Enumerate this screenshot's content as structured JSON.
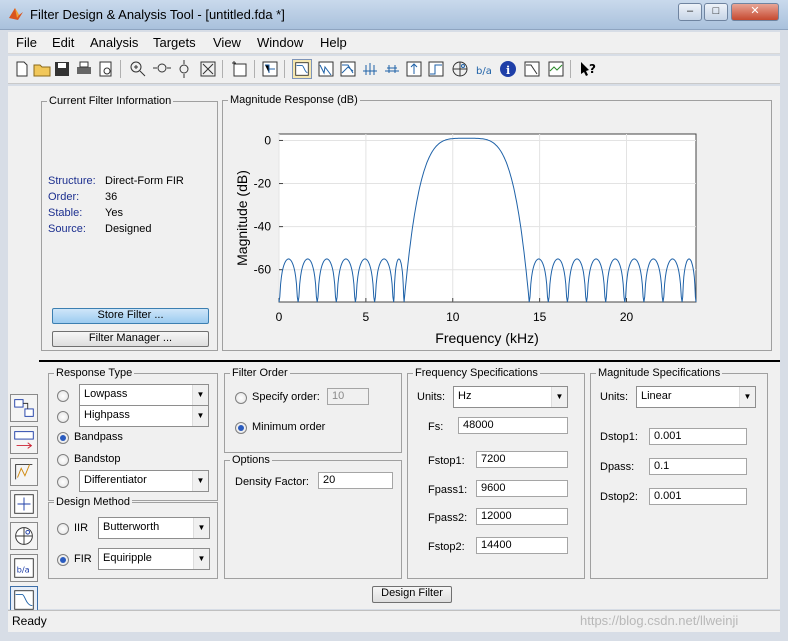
{
  "window": {
    "title": "Filter Design & Analysis Tool  - [untitled.fda *]",
    "min_glyph": "–",
    "max_glyph": "□",
    "close_glyph": "✕"
  },
  "menu": [
    "File",
    "Edit",
    "Analysis",
    "Targets",
    "View",
    "Window",
    "Help"
  ],
  "current_filter": {
    "title": "Current Filter Information",
    "structure_label": "Structure:",
    "structure_value": "Direct-Form FIR",
    "order_label": "Order:",
    "order_value": "36",
    "stable_label": "Stable:",
    "stable_value": "Yes",
    "source_label": "Source:",
    "source_value": "Designed",
    "store_button": "Store Filter ...",
    "manager_button": "Filter Manager ..."
  },
  "plot": {
    "panel_title": "Magnitude Response (dB)",
    "colors": {
      "line": "#1f62a8",
      "grid": "#e3e3e3"
    }
  },
  "chart_data": {
    "type": "line",
    "title": "",
    "xlabel": "Frequency (kHz)",
    "ylabel": "Magnitude (dB)",
    "xlim": [
      0,
      24
    ],
    "ylim": [
      -75,
      3
    ],
    "xticks": [
      0,
      5,
      10,
      15,
      20
    ],
    "yticks": [
      0,
      -20,
      -40,
      -60
    ],
    "grid": true,
    "passband_khz": [
      9.6,
      12.0
    ],
    "stopband_edges_khz": [
      7.2,
      14.4
    ],
    "stopband_level_db": -55,
    "series": [
      {
        "values_desc": "equiripple bandpass response"
      }
    ]
  },
  "response_type": {
    "title": "Response Type",
    "options": [
      {
        "label": "Lowpass",
        "kind": "select"
      },
      {
        "label": "Highpass",
        "kind": "select"
      },
      {
        "label": "Bandpass",
        "kind": "text",
        "selected": true
      },
      {
        "label": "Bandstop",
        "kind": "text"
      },
      {
        "label": "Differentiator",
        "kind": "select"
      }
    ]
  },
  "design_method": {
    "title": "Design Method",
    "iir_label": "IIR",
    "iir_value": "Butterworth",
    "fir_label": "FIR",
    "fir_value": "Equiripple"
  },
  "filter_order": {
    "title": "Filter Order",
    "specify_label": "Specify order:",
    "specify_value": "10",
    "minimum_label": "Minimum order"
  },
  "options": {
    "title": "Options",
    "density_label": "Density Factor:",
    "density_value": "20"
  },
  "freq_specs": {
    "title": "Frequency Specifications",
    "units_label": "Units:",
    "units_value": "Hz",
    "fs_label": "Fs:",
    "fs_value": "48000",
    "fstop1_label": "Fstop1:",
    "fstop1_value": "7200",
    "fpass1_label": "Fpass1:",
    "fpass1_value": "9600",
    "fpass2_label": "Fpass2:",
    "fpass2_value": "12000",
    "fstop2_label": "Fstop2:",
    "fstop2_value": "14400"
  },
  "mag_specs": {
    "title": "Magnitude Specifications",
    "units_label": "Units:",
    "units_value": "Linear",
    "dstop1_label": "Dstop1:",
    "dstop1_value": "0.001",
    "dpass_label": "Dpass:",
    "dpass_value": "0.1",
    "dstop2_label": "Dstop2:",
    "dstop2_value": "0.001"
  },
  "design_button": "Design Filter",
  "status": "Ready",
  "watermark": "https://blog.csdn.net/llweinji"
}
